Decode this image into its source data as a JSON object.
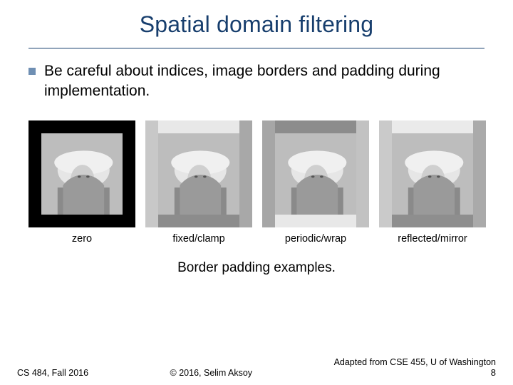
{
  "title": "Spatial domain filtering",
  "bullet": "Be careful about indices, image borders and padding during implementation.",
  "figures": {
    "items": [
      {
        "label": "zero"
      },
      {
        "label": "fixed/clamp"
      },
      {
        "label": "periodic/wrap"
      },
      {
        "label": "reflected/mirror"
      }
    ]
  },
  "caption": "Border padding examples.",
  "footer": {
    "left": "CS 484, Fall 2016",
    "center": "© 2016, Selim Aksoy",
    "right_line": "Adapted from CSE 455, U of Washington",
    "page": "8"
  }
}
